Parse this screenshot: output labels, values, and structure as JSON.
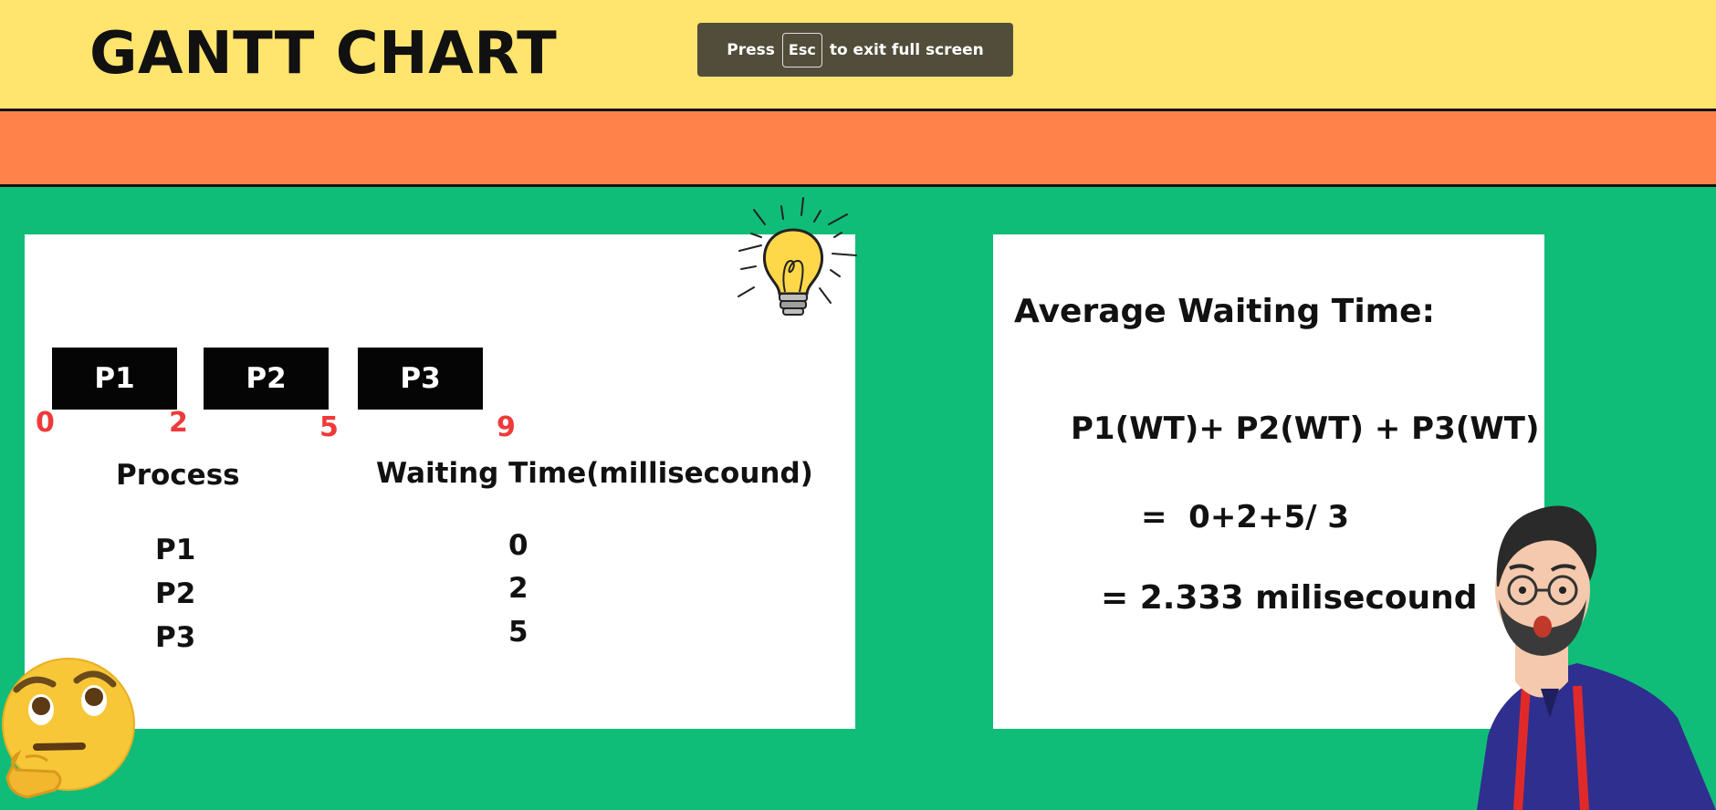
{
  "header": {
    "title": "GANTT CHART"
  },
  "toast": {
    "press": "Press",
    "key": "Esc",
    "message": "to exit full screen"
  },
  "gantt": {
    "bars": [
      {
        "label": "P1"
      },
      {
        "label": "P2"
      },
      {
        "label": "P3"
      }
    ],
    "ticks": [
      "0",
      "2",
      "5",
      "9"
    ]
  },
  "table": {
    "headers": {
      "process": "Process",
      "waiting": "Waiting Time(millisecound)"
    },
    "rows": [
      {
        "process": "P1",
        "waiting": "0"
      },
      {
        "process": "P2",
        "waiting": "2"
      },
      {
        "process": "P3",
        "waiting": "5"
      }
    ]
  },
  "average": {
    "title": "Average Waiting Time:",
    "formula": "P1(WT)+ P2(WT) + P3(WT)",
    "calc": "=  0+2+5/ 3",
    "result": "= 2.333 milisecound"
  },
  "colors": {
    "background": "#10bd78",
    "header": "#ffe46e",
    "band": "#ff824b",
    "tick": "#ef3a3a"
  },
  "icons": [
    "lightbulb-icon",
    "thinking-face-icon",
    "surprised-man-illustration"
  ]
}
